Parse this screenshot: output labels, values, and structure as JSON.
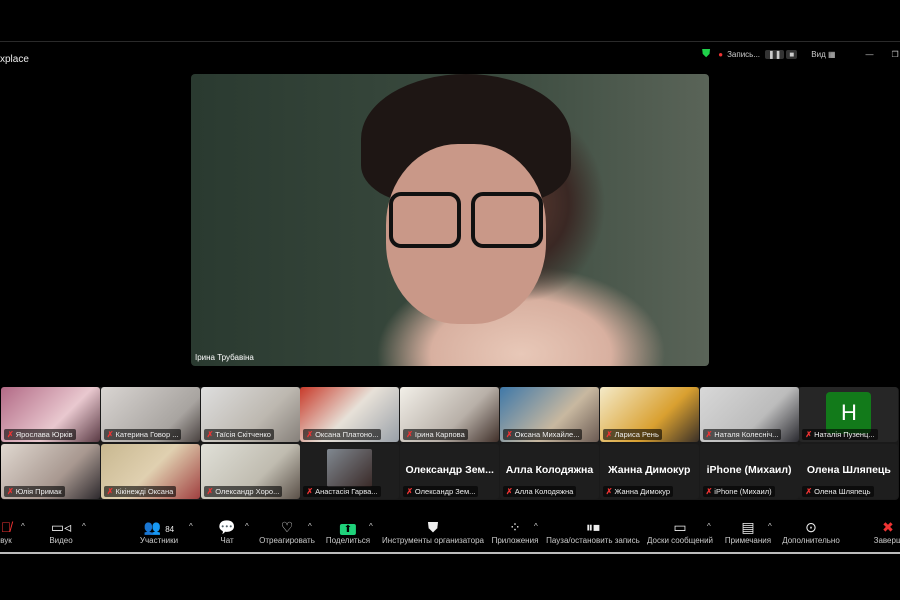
{
  "window": {
    "title": "xplace",
    "record_label": "Запись...",
    "view_label": "Вид",
    "colors": {
      "shield": "#1fd14a",
      "record": "#e33"
    }
  },
  "main_video": {
    "name": "Ірина  Трубавіна"
  },
  "gallery": {
    "row1": [
      "Ярослава Юрків",
      "Катерина Говор ...",
      "Таїсія Скітченко",
      "Оксана Платоно...",
      "Ірина Карпова",
      "Оксана Михайле...",
      "Лариса Рень",
      "Наталя Колесніч...",
      "Наталія Пузенц..."
    ],
    "row2": [
      "Юлія Примак",
      "Кікінежді Оксана",
      "Олександр Хоро...",
      "Анастасія Гарва..."
    ],
    "name_only": [
      {
        "big": "Олександр  Зем...",
        "small": "Олександр Зем..."
      },
      {
        "big": "Алла Колодяжна",
        "small": "Алла Колодяжна"
      },
      {
        "big": "Жанна Димокур",
        "small": "Жанна Димокур"
      },
      {
        "big": "iPhone (Михаил)",
        "small": "iPhone (Михаил)"
      },
      {
        "big": "Олена Шляпець",
        "small": "Олена Шляпець"
      }
    ],
    "avatar_letter": "Н",
    "avatar_color": "#127a1a"
  },
  "toolbar": {
    "audio": "вук",
    "video": "Видео",
    "participants": "Участники",
    "participants_count": "84",
    "chat": "Чат",
    "react": "Отреагировать",
    "share": "Поделиться",
    "host_tools": "Инструменты организатора",
    "apps": "Приложения",
    "record": "Пауза/остановить запись",
    "whiteboards": "Доски сообщений",
    "notes": "Примечания",
    "more": "Дополнительно",
    "end": "Заверш",
    "share_color": "#1fd17a",
    "end_color": "#e33"
  }
}
